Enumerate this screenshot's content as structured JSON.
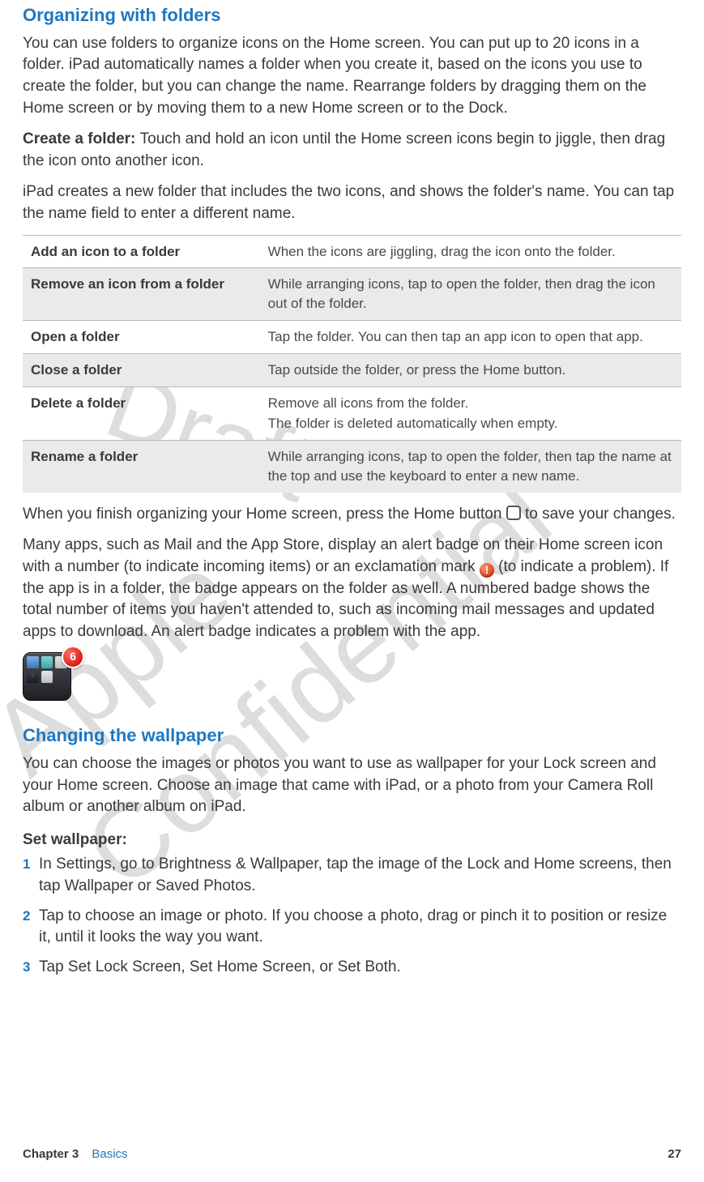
{
  "watermarks": {
    "draft": "Draft",
    "confidential": "Apple Confidential"
  },
  "sections": {
    "folders": {
      "heading": "Organizing with folders",
      "intro": "You can use folders to organize icons on the Home screen. You can put up to 20 icons in a folder. iPad automatically names a folder when you create it, based on the icons you use to create the folder, but you can change the name. Rearrange folders by dragging them on the Home screen or by moving them to a new Home screen or to the Dock.",
      "create_label": "Create a folder:  ",
      "create_text": "Touch and hold an icon until the Home screen icons begin to jiggle, then drag the icon onto another icon.",
      "after_create": "iPad creates a new folder that includes the two icons, and shows the folder's name. You can tap the name field to enter a different name.",
      "table": [
        {
          "action": "Add an icon to a folder",
          "desc": "When the icons are jiggling, drag the icon onto the folder."
        },
        {
          "action": "Remove an icon from a folder",
          "desc": "While arranging icons, tap to open the folder, then drag the icon out of the folder."
        },
        {
          "action": "Open a folder",
          "desc": "Tap the folder. You can then tap an app icon to open that app."
        },
        {
          "action": "Close a folder",
          "desc": "Tap outside the folder, or press the Home button."
        },
        {
          "action": "Delete a folder",
          "desc": "Remove all icons from the folder.",
          "desc2": "The folder is deleted automatically when empty."
        },
        {
          "action": "Rename a folder",
          "desc": "While arranging icons, tap to open the folder, then tap the name at the top and use the keyboard to enter a new name."
        }
      ],
      "finish_a": "When you finish organizing your Home screen, press the Home button ",
      "finish_b": " to save your changes.",
      "badge_a": "Many apps, such as Mail and the App Store, display an alert badge on their Home screen icon with a number (to indicate incoming items) or an exclamation mark ",
      "badge_b": " (to indicate a problem). If the app is in a folder, the badge appears on the folder as well. A numbered badge shows the total number of items you haven't attended to, such as incoming mail messages and updated apps to download. An alert badge indicates a problem with the app.",
      "badge_count": "6",
      "alert_glyph": "!"
    },
    "wallpaper": {
      "heading": "Changing the wallpaper",
      "intro": "You can choose the images or photos you want to use as wallpaper for your Lock screen and your Home screen. Choose an image that came with iPad, or a photo from your Camera Roll album or another album on iPad.",
      "steps_label": "Set wallpaper:",
      "steps": [
        "In Settings, go to Brightness & Wallpaper, tap the image of the Lock and Home screens, then tap Wallpaper or Saved Photos.",
        "Tap to choose an image or photo. If you choose a photo, drag or pinch it to position or resize it, until it looks the way you want.",
        "Tap Set Lock Screen, Set Home Screen, or Set Both."
      ]
    }
  },
  "footer": {
    "chapter": "Chapter 3",
    "title": "Basics",
    "page": "27"
  }
}
